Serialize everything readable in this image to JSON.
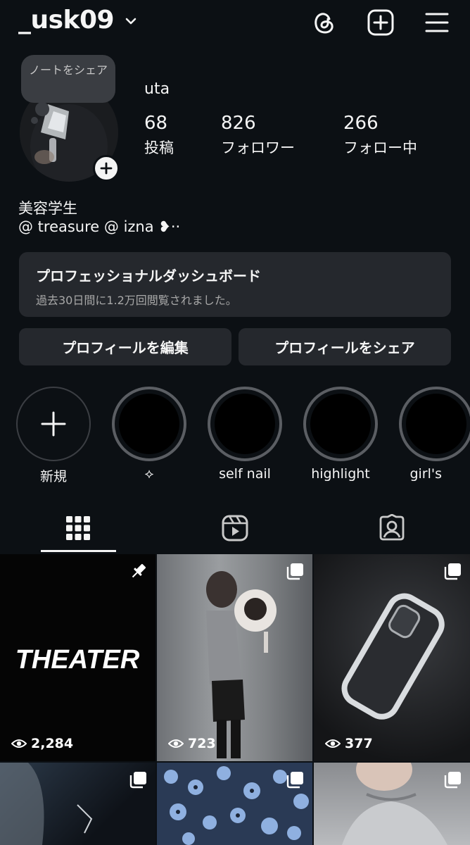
{
  "header": {
    "username": "_usk09",
    "icons": [
      "chevron-down-icon",
      "threads-icon",
      "create-icon",
      "menu-icon"
    ]
  },
  "profile": {
    "note": "ノートをシェア",
    "display_name": "uta",
    "stats": [
      {
        "value": "68",
        "label": "投稿"
      },
      {
        "value": "826",
        "label": "フォロワー"
      },
      {
        "value": "266",
        "label": "フォロー中"
      }
    ],
    "bio": [
      "美容学生",
      "@ treasure @ izna ❥··"
    ]
  },
  "dashboard": {
    "title": "プロフェッショナルダッシュボード",
    "subtitle": "過去30日間に1.2万回閲覧されました。"
  },
  "buttons": {
    "edit": "プロフィールを編集",
    "share": "プロフィールをシェア"
  },
  "highlights": [
    {
      "label": "新規"
    },
    {
      "label": "⟡"
    },
    {
      "label": "self nail"
    },
    {
      "label": "highlight"
    },
    {
      "label": "girl's"
    }
  ],
  "tabs": [
    "grid-icon",
    "reels-icon",
    "tagged-icon"
  ],
  "posts": [
    {
      "title": "THEATER",
      "views": "2,284",
      "badge": "pin-icon"
    },
    {
      "views": "723",
      "badge": "carousel-icon"
    },
    {
      "views": "377",
      "badge": "carousel-icon"
    },
    {
      "badge": "carousel-icon"
    },
    {
      "badge": "carousel-icon"
    },
    {
      "badge": "carousel-icon"
    }
  ],
  "colors": {
    "background": "#0c1014",
    "surface": "#25282d",
    "text": "#f5f5f5",
    "muted": "#a8a8a8"
  }
}
